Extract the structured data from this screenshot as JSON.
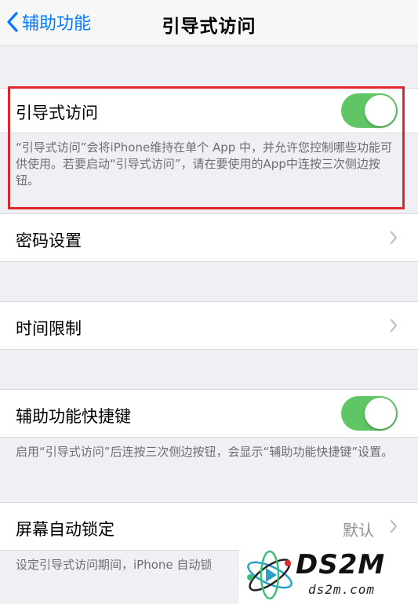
{
  "nav": {
    "back_label": "辅助功能",
    "title": "引导式访问"
  },
  "guided_access": {
    "label": "引导式访问",
    "toggle_on": true,
    "description": "“引导式访问”会将iPhone维持在单个 App 中，并允许您控制哪些功能可供使用。若要启动“引导式访问”，请在要使用的App中连按三次侧边按钮。"
  },
  "passcode_settings": {
    "label": "密码设置"
  },
  "time_limits": {
    "label": "时间限制"
  },
  "accessibility_shortcut": {
    "label": "辅助功能快捷键",
    "toggle_on": true,
    "description": "启用“引导式访问”后连按三次侧边按钮，会显示“辅助功能快捷键”设置。"
  },
  "auto_lock": {
    "label": "屏幕自动锁定",
    "value": "默认",
    "description": "设定引导式访问期间，iPhone 自动锁"
  },
  "watermark": {
    "logo_text": "DS2M",
    "site": "ds2m.com"
  },
  "colors": {
    "accent": "#007aff",
    "toggle_on": "#5fc565",
    "highlight": "#e0262a",
    "background": "#efeff4"
  }
}
